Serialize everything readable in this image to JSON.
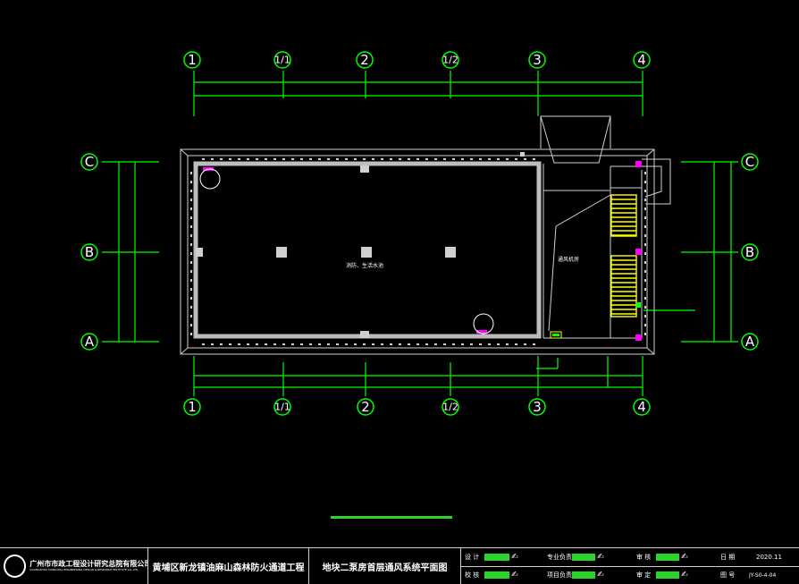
{
  "axes": {
    "columns": [
      "1",
      "1/1",
      "2",
      "1/2",
      "3",
      "4"
    ],
    "rows": [
      "C",
      "B",
      "A"
    ]
  },
  "rooms": {
    "main_room": "消防、生活水池",
    "side_room": "通风机房"
  },
  "title_block": {
    "company_cn": "广州市市政工程设计研究总院有限公司",
    "company_en": "GUANGZHOU MUNICIPAL ENGINEERING DESIGN & RESEARCH INSTITUTE CO.,LTD.",
    "project_name": "黄埔区新龙镇油麻山森林防火通道工程",
    "drawing_title": "地块二泵房首层通风系统平面图",
    "labels": {
      "design": "设 计",
      "check": "校 核",
      "specialty_lead": "专业负责",
      "project_lead": "项目负责",
      "review": "审 核",
      "approve": "审 定",
      "date": "日 期",
      "drawing_no": "图 号"
    },
    "values": {
      "date": "2020.11",
      "drawing_no": "JY-S0-4-04"
    }
  },
  "colors": {
    "background": "#000000",
    "axis": "#00ff00",
    "wall": "#cfcfcf",
    "stair": "#ffff00",
    "device": "#ff00ff"
  }
}
